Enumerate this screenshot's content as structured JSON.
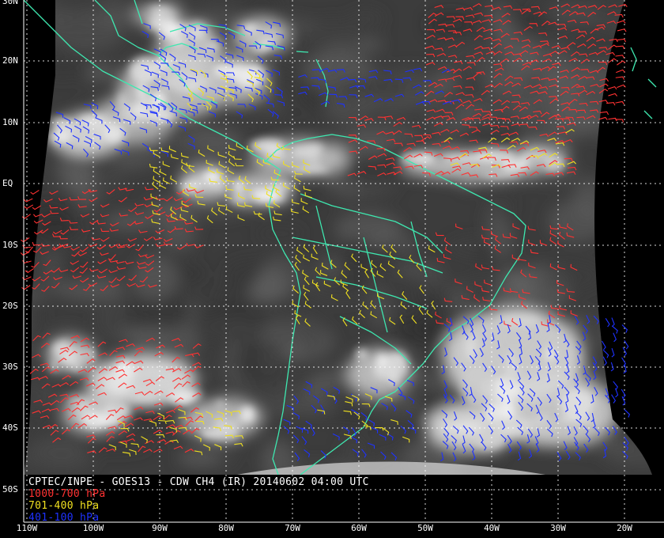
{
  "caption": {
    "title": "CPTEC/INPE - GOES13 - CDW CH4 (IR) 20140602 04:00 UTC",
    "legend": [
      {
        "label": "1000-700 hPa",
        "color": "#ff3232"
      },
      {
        "label": "701-400 hPa",
        "color": "#f0e020"
      },
      {
        "label": "401-100 hPa",
        "color": "#1e32ff"
      }
    ]
  },
  "lat_labels": [
    "30N",
    "20N",
    "10N",
    "EQ",
    "10S",
    "20S",
    "30S",
    "40S",
    "50S"
  ],
  "lon_labels": [
    "110W",
    "100W",
    "90W",
    "80W",
    "70W",
    "60W",
    "50W",
    "40W",
    "30W",
    "20W"
  ],
  "colors": {
    "background": "#000000",
    "coastline": "#3ee8b0",
    "grid": "#ffffff",
    "ir_cloud_dark": "#3a3a3a",
    "ir_cloud_bright": "#f2f2f2"
  }
}
